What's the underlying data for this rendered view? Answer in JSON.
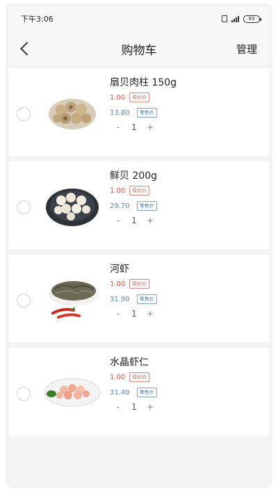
{
  "status_bar": {
    "time": "下午3:06",
    "battery": "93"
  },
  "nav": {
    "title": "购物车",
    "manage": "管理"
  },
  "items": [
    {
      "name": "扇贝肉柱 150g",
      "orig_price": "1.00",
      "orig_tag": "原价价",
      "vip_price": "13.80",
      "vip_tag": "零售价",
      "qty": "1",
      "minus": "-",
      "plus": "+",
      "image": "scallop-meat"
    },
    {
      "name": "鲜贝 200g",
      "orig_price": "1.00",
      "orig_tag": "原价价",
      "vip_price": "29.70",
      "vip_tag": "零售价",
      "qty": "1",
      "minus": "-",
      "plus": "+",
      "image": "fresh-scallop"
    },
    {
      "name": "河虾",
      "orig_price": "1.00",
      "orig_tag": "原价价",
      "vip_price": "31.90",
      "vip_tag": "零售价",
      "qty": "1",
      "minus": "-",
      "plus": "+",
      "image": "river-shrimp"
    },
    {
      "name": "水晶虾仁",
      "orig_price": "1.00",
      "orig_tag": "原价价",
      "vip_price": "31.40",
      "vip_tag": "零售价",
      "qty": "1",
      "minus": "-",
      "plus": "+",
      "image": "crystal-shrimp"
    }
  ],
  "colors": {
    "orig_price": "#d25a4c",
    "vip_price": "#5a86b8",
    "background": "#f4f4f4"
  }
}
